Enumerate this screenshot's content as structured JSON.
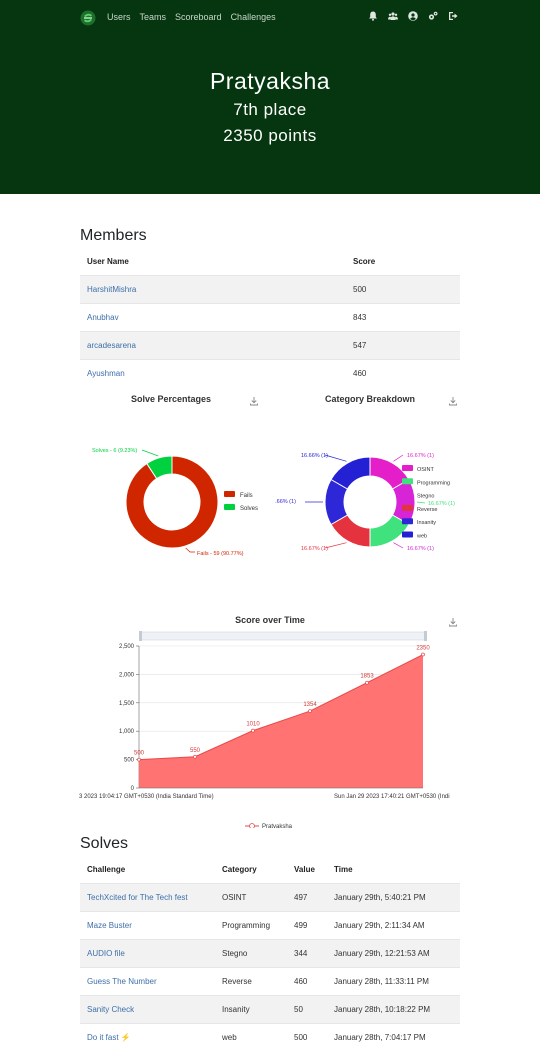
{
  "nav": {
    "links": [
      "Users",
      "Teams",
      "Scoreboard",
      "Challenges"
    ],
    "icons": [
      "bell-icon",
      "users-icon",
      "user-circle-icon",
      "settings-icon",
      "logout-icon"
    ]
  },
  "hero": {
    "name": "Pratyaksha",
    "place": "7th place",
    "points": "2350 points"
  },
  "members": {
    "title": "Members",
    "headers": [
      "User Name",
      "Score"
    ],
    "rows": [
      {
        "name": "HarshitMishra",
        "score": "500"
      },
      {
        "name": "Anubhav",
        "score": "843"
      },
      {
        "name": "arcadesarena",
        "score": "547"
      },
      {
        "name": "Ayushman",
        "score": "460"
      }
    ]
  },
  "charts": {
    "solve_title": "Solve Percentages",
    "category_title": "Category Breakdown",
    "score_title": "Score over Time"
  },
  "chart_data": [
    {
      "type": "pie",
      "title": "Solve Percentages",
      "categories": [
        "Fails",
        "Solves"
      ],
      "values": [
        59,
        6
      ],
      "labels": [
        "Fails - 59 (90.77%)",
        "Solves - 6 (9.23%)"
      ],
      "colors": [
        "#cf2600",
        "#00d13f"
      ]
    },
    {
      "type": "pie",
      "title": "Category Breakdown",
      "categories": [
        "OSINT",
        "Programming",
        "Stegno",
        "Reverse",
        "Insanity",
        "web"
      ],
      "values": [
        1,
        1,
        1,
        1,
        1,
        1
      ],
      "labels": [
        "16.67% (1)",
        "16.67% (1)",
        "16.67% (1)",
        "16.67% (1)",
        "16.66% (1)",
        "16.66% (1)"
      ],
      "colors": [
        "#e41fc9",
        "#3fe27c",
        "#d624d6",
        "#e5323f",
        "#2d27d8",
        "#2420d4"
      ]
    },
    {
      "type": "area",
      "title": "Score over Time",
      "x_labels": [
        "3 2023 19:04:17 GMT+0530 (India Standard Time)",
        "Sun Jan 29 2023 17:40:21 GMT+0530 (Indi"
      ],
      "series": [
        {
          "name": "Pratyaksha",
          "values": [
            500,
            550,
            1010,
            1354,
            1853,
            2350
          ]
        }
      ],
      "ylim": [
        0,
        2500
      ],
      "yticks": [
        "0",
        "500",
        "1,000",
        "1,500",
        "2,000",
        "2,500"
      ],
      "color": "#ff6b6b"
    }
  ],
  "solves": {
    "title": "Solves",
    "headers": [
      "Challenge",
      "Category",
      "Value",
      "Time"
    ],
    "rows": [
      {
        "challenge": "TechXcited for The Tech fest",
        "category": "OSINT",
        "value": "497",
        "time": "January 29th, 5:40:21 PM"
      },
      {
        "challenge": "Maze Buster",
        "category": "Programming",
        "value": "499",
        "time": "January 29th, 2:11:34 AM"
      },
      {
        "challenge": "AUDIO file",
        "category": "Stegno",
        "value": "344",
        "time": "January 29th, 12:21:53 AM"
      },
      {
        "challenge": "Guess The Number",
        "category": "Reverse",
        "value": "460",
        "time": "January 28th, 11:33:11 PM"
      },
      {
        "challenge": "Sanity Check",
        "category": "Insanity",
        "value": "50",
        "time": "January 28th, 10:18:22 PM"
      },
      {
        "challenge": "Do it fast ⚡",
        "category": "web",
        "value": "500",
        "time": "January 28th, 7:04:17 PM"
      }
    ]
  }
}
